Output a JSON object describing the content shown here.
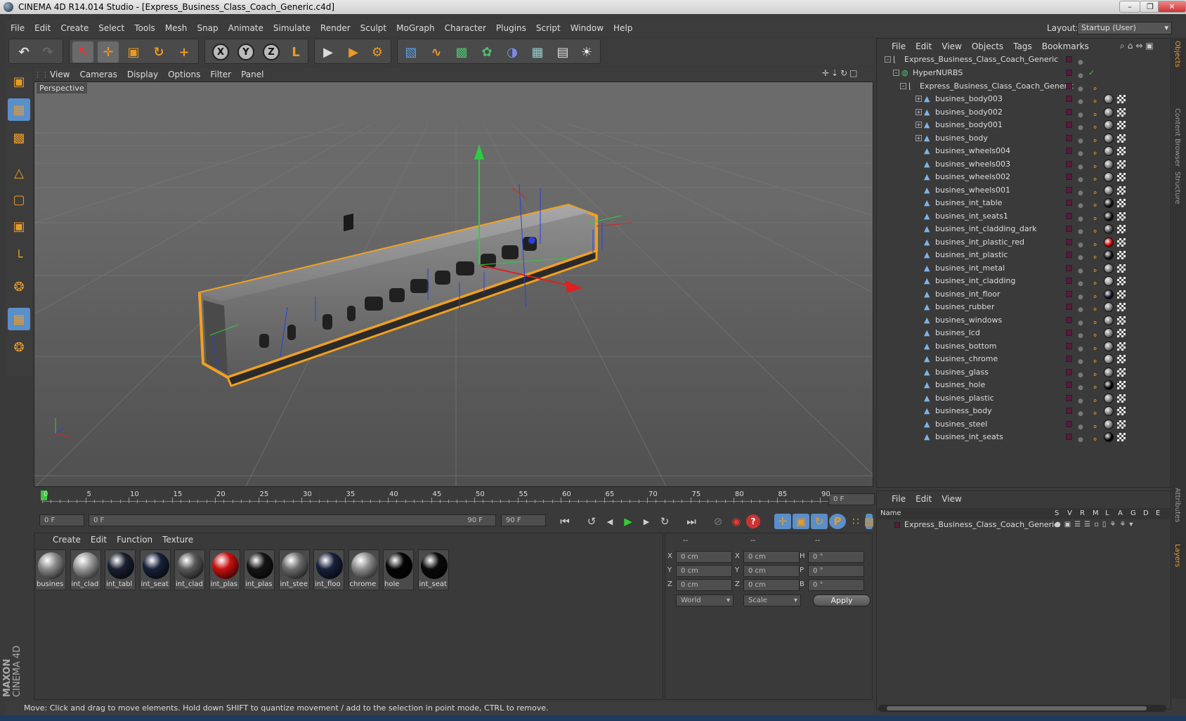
{
  "window": {
    "title": "CINEMA 4D R14.014 Studio - [Express_Business_Class_Coach_Generic.c4d]",
    "minimize": "–",
    "restore": "❐",
    "close": "✕"
  },
  "menubar": [
    "File",
    "Edit",
    "Create",
    "Select",
    "Tools",
    "Mesh",
    "Snap",
    "Animate",
    "Simulate",
    "Render",
    "Sculpt",
    "MoGraph",
    "Character",
    "Plugins",
    "Script",
    "Window",
    "Help"
  ],
  "layout": {
    "label": "Layout:",
    "value": "Startup (User)"
  },
  "toolbar": {
    "undo": "↶",
    "redo": "↷",
    "live_select": "↖",
    "move": "✛",
    "scale": "▣",
    "rotate": "↻",
    "create": "+",
    "axis_x": "X",
    "axis_y": "Y",
    "axis_z": "Z",
    "coord": "L",
    "render_view": "▶",
    "render": "▶",
    "render_settings": "⚙",
    "cube": "▧",
    "spline": "∿",
    "nurbs": "▩",
    "array": "✿",
    "deformer": "◑",
    "floor": "▦",
    "camera": "▤",
    "light": "☀"
  },
  "lefttools": [
    "▣",
    "▦",
    "▩",
    "△",
    "▢",
    "▣",
    "└",
    "❂",
    "▦",
    "❂"
  ],
  "viewport": {
    "menu": [
      "View",
      "Cameras",
      "Display",
      "Options",
      "Filter",
      "Panel"
    ],
    "label": "Perspective",
    "icons": "✛⇣↻□"
  },
  "timeline": {
    "ticks": [
      "0",
      "5",
      "10",
      "15",
      "20",
      "25",
      "30",
      "35",
      "40",
      "45",
      "50",
      "55",
      "60",
      "65",
      "70",
      "75",
      "80",
      "85",
      "90"
    ],
    "current_frame": "0 F",
    "start": "0 F",
    "slider_start": "0 F",
    "slider_end": "90 F",
    "end": "90 F"
  },
  "transport": {
    "first": "⏮",
    "prev_key": "↺",
    "prev": "◀",
    "play": "▶",
    "next": "▶",
    "next_key": "↻",
    "last": "⏭",
    "record": "⊘",
    "autokey": "◉",
    "help": "?",
    "k_move": "✛",
    "k_scale": "▣",
    "k_rotate": "↻",
    "k_param": "P",
    "k_points": "∷",
    "timeline_btn": "▤"
  },
  "materials": {
    "menu": [
      "Create",
      "Edit",
      "Function",
      "Texture"
    ],
    "items": [
      {
        "label": "busines",
        "color": "#8a8a8a"
      },
      {
        "label": "int_clad",
        "color": "#9a9a9a"
      },
      {
        "label": "int_tabl",
        "color": "#1a2030"
      },
      {
        "label": "int_seat",
        "color": "#162238"
      },
      {
        "label": "int_clad",
        "color": "#5a5a5a"
      },
      {
        "label": "int_plas",
        "color": "#c81010"
      },
      {
        "label": "int_plas",
        "color": "#151515"
      },
      {
        "label": "int_stee",
        "color": "#6e6e6e"
      },
      {
        "label": "int_floo",
        "color": "#18203a"
      },
      {
        "label": "chrome",
        "color": "#8e8e8e"
      },
      {
        "label": "hole",
        "color": "#050505"
      },
      {
        "label": "int_seat",
        "color": "#0a0a0a"
      }
    ]
  },
  "coords": {
    "head": [
      "--",
      "--",
      "--"
    ],
    "rows": [
      {
        "a": "X",
        "pos": "0 cm",
        "b": "X",
        "size": "0 cm",
        "c": "H",
        "rot": "0 °"
      },
      {
        "a": "Y",
        "pos": "0 cm",
        "b": "Y",
        "size": "0 cm",
        "c": "P",
        "rot": "0 °"
      },
      {
        "a": "Z",
        "pos": "0 cm",
        "b": "Z",
        "size": "0 cm",
        "c": "B",
        "rot": "0 °"
      }
    ],
    "space": "World",
    "mode": "Scale",
    "apply": "Apply"
  },
  "objects": {
    "menu": [
      "File",
      "Edit",
      "View",
      "Objects",
      "Tags",
      "Bookmarks"
    ],
    "root": "Express_Business_Class_Coach_Generic",
    "hypernurbs": "HyperNURBS",
    "group": "Express_Business_Class_Coach_Generic",
    "items": [
      {
        "name": "busines_body003",
        "expand": "+",
        "mat": "#777"
      },
      {
        "name": "busines_body002",
        "expand": "+",
        "mat": "#777"
      },
      {
        "name": "busines_body001",
        "expand": "+",
        "mat": "#777"
      },
      {
        "name": "busines_body",
        "expand": "+",
        "mat": "#777"
      },
      {
        "name": "busines_wheels004",
        "expand": "",
        "mat": "#777"
      },
      {
        "name": "busines_wheels003",
        "expand": "",
        "mat": "#777"
      },
      {
        "name": "busines_wheels002",
        "expand": "",
        "mat": "#777"
      },
      {
        "name": "busines_wheels001",
        "expand": "",
        "mat": "#777"
      },
      {
        "name": "busines_int_table",
        "expand": "",
        "mat": "#111"
      },
      {
        "name": "busines_int_seats1",
        "expand": "",
        "mat": "#111"
      },
      {
        "name": "busines_int_cladding_dark",
        "expand": "",
        "mat": "#444"
      },
      {
        "name": "busines_int_plastic_red",
        "expand": "",
        "mat": "#c00"
      },
      {
        "name": "busines_int_plastic",
        "expand": "",
        "mat": "#111"
      },
      {
        "name": "busines_int_metal",
        "expand": "",
        "mat": "#777"
      },
      {
        "name": "busines_int_cladding",
        "expand": "",
        "mat": "#999"
      },
      {
        "name": "busines_int_floor",
        "expand": "",
        "mat": "#112"
      },
      {
        "name": "busines_rubber",
        "expand": "",
        "mat": "#777"
      },
      {
        "name": "busines_windows",
        "expand": "",
        "mat": "#777"
      },
      {
        "name": "busines_lcd",
        "expand": "",
        "mat": "#777"
      },
      {
        "name": "busines_bottom",
        "expand": "",
        "mat": "#777"
      },
      {
        "name": "busines_chrome",
        "expand": "",
        "mat": "#888"
      },
      {
        "name": "busines_glass",
        "expand": "",
        "mat": "#777"
      },
      {
        "name": "busines_hole",
        "expand": "",
        "mat": "#000"
      },
      {
        "name": "busines_plastic",
        "expand": "",
        "mat": "#777"
      },
      {
        "name": "business_body",
        "expand": "",
        "mat": "#777"
      },
      {
        "name": "busines_steel",
        "expand": "",
        "mat": "#777"
      },
      {
        "name": "busines_int_seats",
        "expand": "",
        "mat": "#000"
      }
    ]
  },
  "layers": {
    "menu": [
      "File",
      "Edit",
      "View"
    ],
    "header_name": "Name",
    "columns": [
      "S",
      "V",
      "R",
      "M",
      "L",
      "A",
      "G",
      "D",
      "E"
    ],
    "row": "Express_Business_Class_Coach_Generic"
  },
  "side_tabs": [
    "Objects",
    "Content Browser",
    "Structure",
    "Attributes",
    "Layers"
  ],
  "statusbar": "Move: Click and drag to move elements. Hold down SHIFT to quantize movement / add to the selection in point mode, CTRL to remove.",
  "brand": {
    "line1": "MAXON",
    "line2": "CINEMA 4D"
  }
}
